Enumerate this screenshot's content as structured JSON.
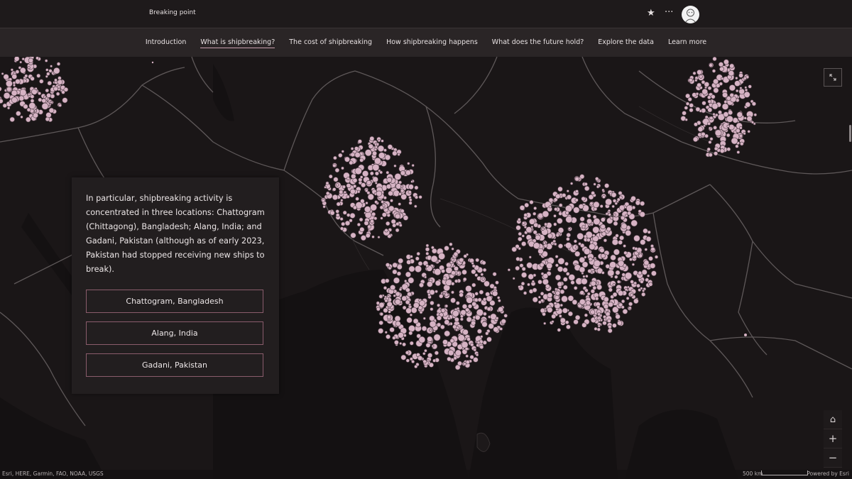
{
  "header": {
    "title": "Breaking point",
    "star_icon": "★",
    "more_icon": "···"
  },
  "nav": {
    "items": [
      {
        "label": "Introduction"
      },
      {
        "label": "What is shipbreaking?"
      },
      {
        "label": "The cost of shipbreaking"
      },
      {
        "label": "How shipbreaking happens"
      },
      {
        "label": "What does the future hold?"
      },
      {
        "label": "Explore the data"
      },
      {
        "label": "Learn more"
      }
    ],
    "active_index": 1
  },
  "card": {
    "text": "In particular, shipbreaking activity is concentrated in three locations: Chattogram (Chittagong), Bangladesh; Alang, India; and Gadani, Pakistan (although as of early 2023, Pakistan had stopped receiving new ships to break).",
    "buttons": [
      "Chattogram, Bangladesh",
      "Alang, India",
      "Gadani, Pakistan"
    ]
  },
  "map": {
    "expand_icon": "expand-icon",
    "home_icon": "⌂",
    "zoom_in": "+",
    "zoom_out": "−",
    "attribution": "Esri, HERE, Garmin, FAO, NOAA, USGS",
    "scale_label": "500 km",
    "powered_by": "Powered by Esri",
    "colors": {
      "cluster_fill": "#d6b3c4",
      "cluster_stroke": "#4a3a42",
      "country_border": "#5e5859",
      "land": "#1d191a",
      "water": "#141112"
    }
  }
}
